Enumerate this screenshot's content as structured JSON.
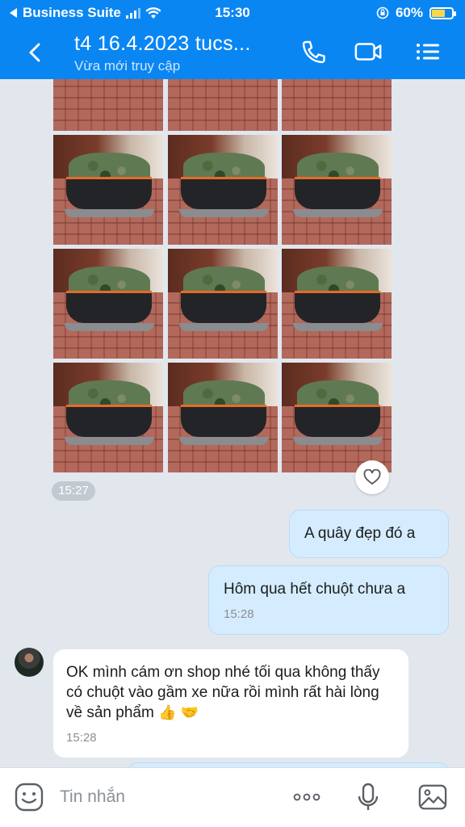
{
  "status_bar": {
    "back_app": "Business Suite",
    "time": "15:30",
    "battery": "60%"
  },
  "header": {
    "title": "t4 16.4.2023 tucs...",
    "subtitle": "Vừa mới truy cập"
  },
  "messages": {
    "photo_time": "15:27",
    "msg1": {
      "text": "A quây đẹp đó a"
    },
    "msg2": {
      "text": "Hôm qua hết chuột chưa a",
      "time": "15:28"
    },
    "msg3": {
      "text": "OK mình cám ơn shop nhé tối qua không thấy có chuột vào gầm xe nữa rồi mình rất hài lòng về sản phẩm",
      "emoji1": "👍",
      "emoji2": "🤝",
      "time": "15:28"
    }
  },
  "input": {
    "placeholder": "Tin nhắn"
  },
  "colors": {
    "header_bg": "#0a86f3",
    "outgoing_bubble": "#d4ecfd",
    "incoming_bubble": "#ffffff",
    "chat_bg": "#e2e7ee"
  }
}
